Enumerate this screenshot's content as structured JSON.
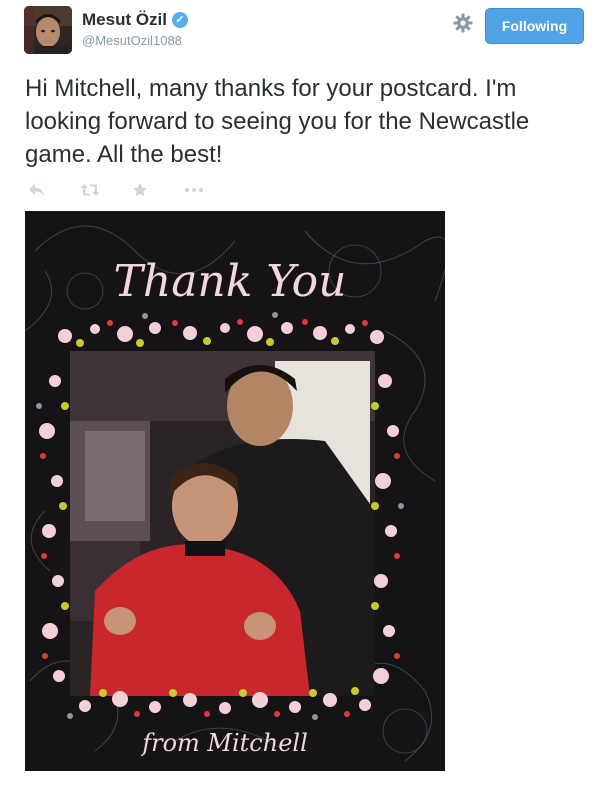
{
  "user": {
    "display_name": "Mesut Özil",
    "handle": "@MesutOzil1088",
    "verified": true
  },
  "follow_button": {
    "label": "Following"
  },
  "tweet": {
    "text": "Hi Mitchell, many thanks for your postcard. I'm looking forward to seeing you for the Newcastle game. All the best!"
  },
  "actions": [
    {
      "icon": "reply-icon"
    },
    {
      "icon": "retweet-icon"
    },
    {
      "icon": "favorite-star-icon"
    },
    {
      "icon": "more-dots-icon"
    }
  ],
  "card": {
    "heading": "Thank You",
    "signature": "from Mitchell"
  },
  "colors": {
    "accent": "#55acee",
    "button": "#4fa3e6",
    "text": "#292f33",
    "muted": "#8899a6",
    "icon": "#ccd6dd"
  }
}
